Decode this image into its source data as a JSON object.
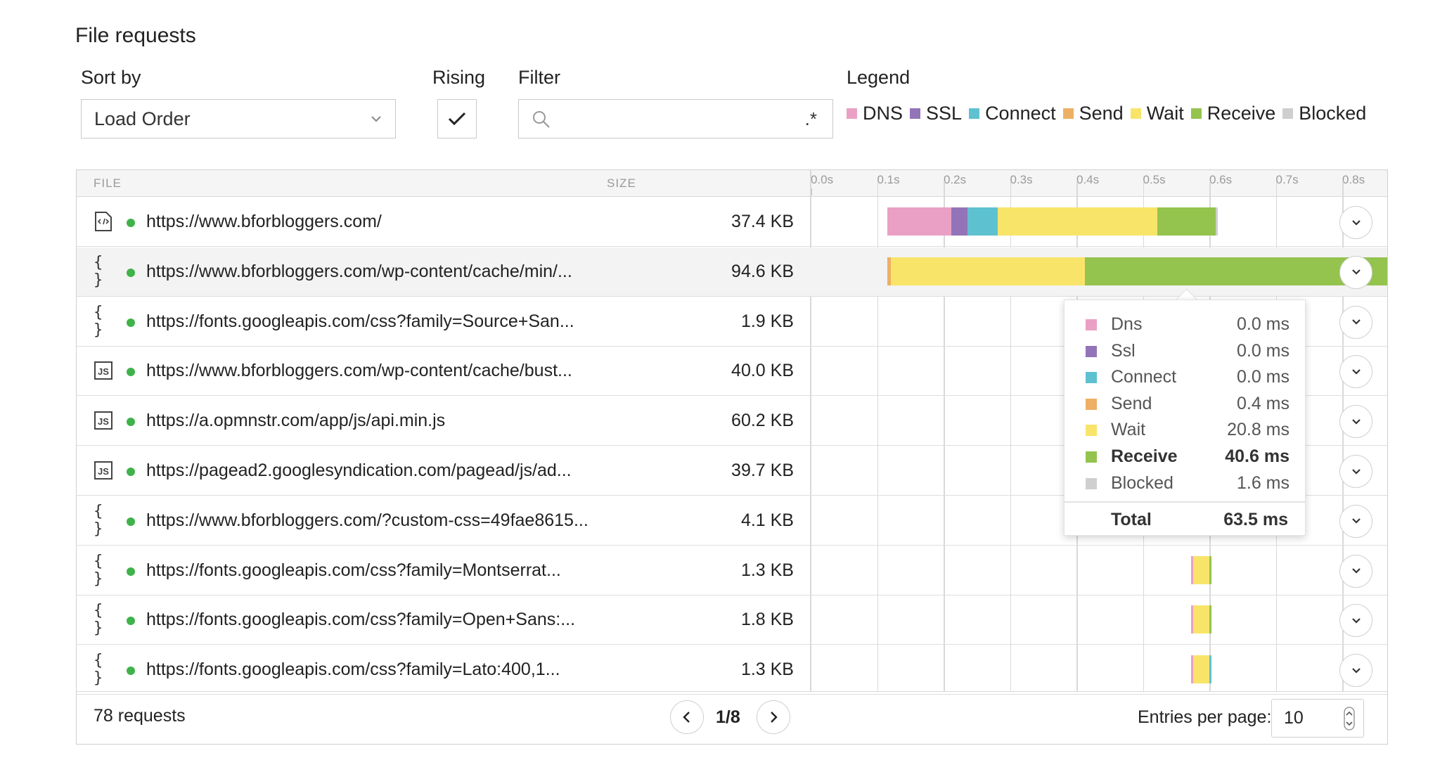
{
  "title": "File requests",
  "controls": {
    "sort_label": "Sort by",
    "sort_value": "Load Order",
    "rising_label": "Rising",
    "rising_checked": true,
    "filter_label": "Filter",
    "filter_value": "",
    "filter_regex_symbol": ".*",
    "legend_label": "Legend"
  },
  "legend": [
    {
      "name": "DNS",
      "color": "#eaa0c4"
    },
    {
      "name": "SSL",
      "color": "#9474b8"
    },
    {
      "name": "Connect",
      "color": "#5ec1d0"
    },
    {
      "name": "Send",
      "color": "#eeb064"
    },
    {
      "name": "Wait",
      "color": "#f9e46a"
    },
    {
      "name": "Receive",
      "color": "#94c34e"
    },
    {
      "name": "Blocked",
      "color": "#cfcfcf"
    }
  ],
  "table": {
    "headers": {
      "file": "FILE",
      "size": "SIZE"
    },
    "ticks": [
      "0.0s",
      "0.1s",
      "0.2s",
      "0.3s",
      "0.4s",
      "0.5s",
      "0.6s",
      "0.7s",
      "0.8s"
    ],
    "rows": [
      {
        "icon": "html-file-icon",
        "icon_glyph": "",
        "url": "https://www.bforbloggers.com/",
        "size": "37.4 KB",
        "timing_s": [
          [
            "DNS",
            0.0,
            0.096
          ],
          [
            "SSL",
            0.096,
            0.121
          ],
          [
            "Connect",
            0.121,
            0.166
          ],
          [
            "Wait",
            0.166,
            0.406
          ],
          [
            "Receive",
            0.406,
            0.494
          ],
          [
            "Blocked",
            0.494,
            0.497
          ]
        ]
      },
      {
        "icon": "css-file-icon",
        "icon_glyph": "{ }",
        "url": "https://www.bforbloggers.com/wp-content/cache/min/...",
        "size": "94.6 KB",
        "highlighted": true,
        "timing_s": [
          [
            "Send",
            0.0,
            0.005
          ],
          [
            "Wait",
            0.005,
            0.297
          ],
          [
            "Receive",
            0.297,
            0.87
          ],
          [
            "Blocked",
            0.87,
            0.885
          ]
        ]
      },
      {
        "icon": "css-file-icon",
        "icon_glyph": "{ }",
        "url": "https://fonts.googleapis.com/css?family=Source+San...",
        "size": "1.9 KB",
        "timing_s": [
          [
            "SSL",
            0.39,
            0.397
          ]
        ]
      },
      {
        "icon": "js-file-icon",
        "icon_glyph": "JS",
        "url": "https://www.bforbloggers.com/wp-content/cache/bust...",
        "size": "40.0 KB",
        "timing_s": [
          [
            "Send",
            0.39,
            0.397
          ]
        ]
      },
      {
        "icon": "js-file-icon",
        "icon_glyph": "JS",
        "url": "https://a.opmnstr.com/app/js/api.min.js",
        "size": "60.2 KB",
        "timing_s": [
          [
            "SSL",
            0.39,
            0.397
          ]
        ]
      },
      {
        "icon": "js-file-icon",
        "icon_glyph": "JS",
        "url": "https://pagead2.googlesyndication.com/pagead/js/ad...",
        "size": "39.7 KB",
        "timing_s": [
          [
            "SSL",
            0.39,
            0.397
          ]
        ]
      },
      {
        "icon": "css-file-icon",
        "icon_glyph": "{ }",
        "url": "https://www.bforbloggers.com/?custom-css=49fae8615...",
        "size": "4.1 KB",
        "timing_s": [
          [
            "SSL",
            0.39,
            0.393
          ],
          [
            "Wait",
            0.393,
            0.399
          ],
          [
            "Wait",
            0.76,
            0.885
          ]
        ]
      },
      {
        "icon": "css-file-icon",
        "icon_glyph": "{ }",
        "url": "https://fonts.googleapis.com/css?family=Montserrat...",
        "size": "1.3 KB",
        "timing_s": [
          [
            "DNS",
            0.457,
            0.46
          ],
          [
            "Wait",
            0.46,
            0.485
          ],
          [
            "Receive",
            0.485,
            0.487
          ]
        ]
      },
      {
        "icon": "css-file-icon",
        "icon_glyph": "{ }",
        "url": "https://fonts.googleapis.com/css?family=Open+Sans:...",
        "size": "1.8 KB",
        "timing_s": [
          [
            "DNS",
            0.457,
            0.46
          ],
          [
            "Wait",
            0.46,
            0.485
          ],
          [
            "Receive",
            0.485,
            0.487
          ]
        ]
      },
      {
        "icon": "css-file-icon",
        "icon_glyph": "{ }",
        "url": "https://fonts.googleapis.com/css?family=Lato:400,1...",
        "size": "1.3 KB",
        "timing_s": [
          [
            "DNS",
            0.457,
            0.46
          ],
          [
            "Wait",
            0.46,
            0.485
          ],
          [
            "Connect",
            0.485,
            0.487
          ]
        ]
      }
    ]
  },
  "tooltip": {
    "rows": [
      {
        "name": "Dns",
        "value": "0.0 ms",
        "color": "#eaa0c4"
      },
      {
        "name": "Ssl",
        "value": "0.0 ms",
        "color": "#9474b8"
      },
      {
        "name": "Connect",
        "value": "0.0 ms",
        "color": "#5ec1d0"
      },
      {
        "name": "Send",
        "value": "0.4 ms",
        "color": "#eeb064"
      },
      {
        "name": "Wait",
        "value": "20.8 ms",
        "color": "#f9e46a"
      },
      {
        "name": "Receive",
        "value": "40.6 ms",
        "color": "#94c34e",
        "bold": true
      },
      {
        "name": "Blocked",
        "value": "1.6 ms",
        "color": "#cfcfcf"
      }
    ],
    "total_label": "Total",
    "total_value": "63.5 ms"
  },
  "footer": {
    "request_count": "78 requests",
    "page_indicator": "1/8",
    "entries_label": "Entries per page:",
    "entries_value": "10"
  }
}
